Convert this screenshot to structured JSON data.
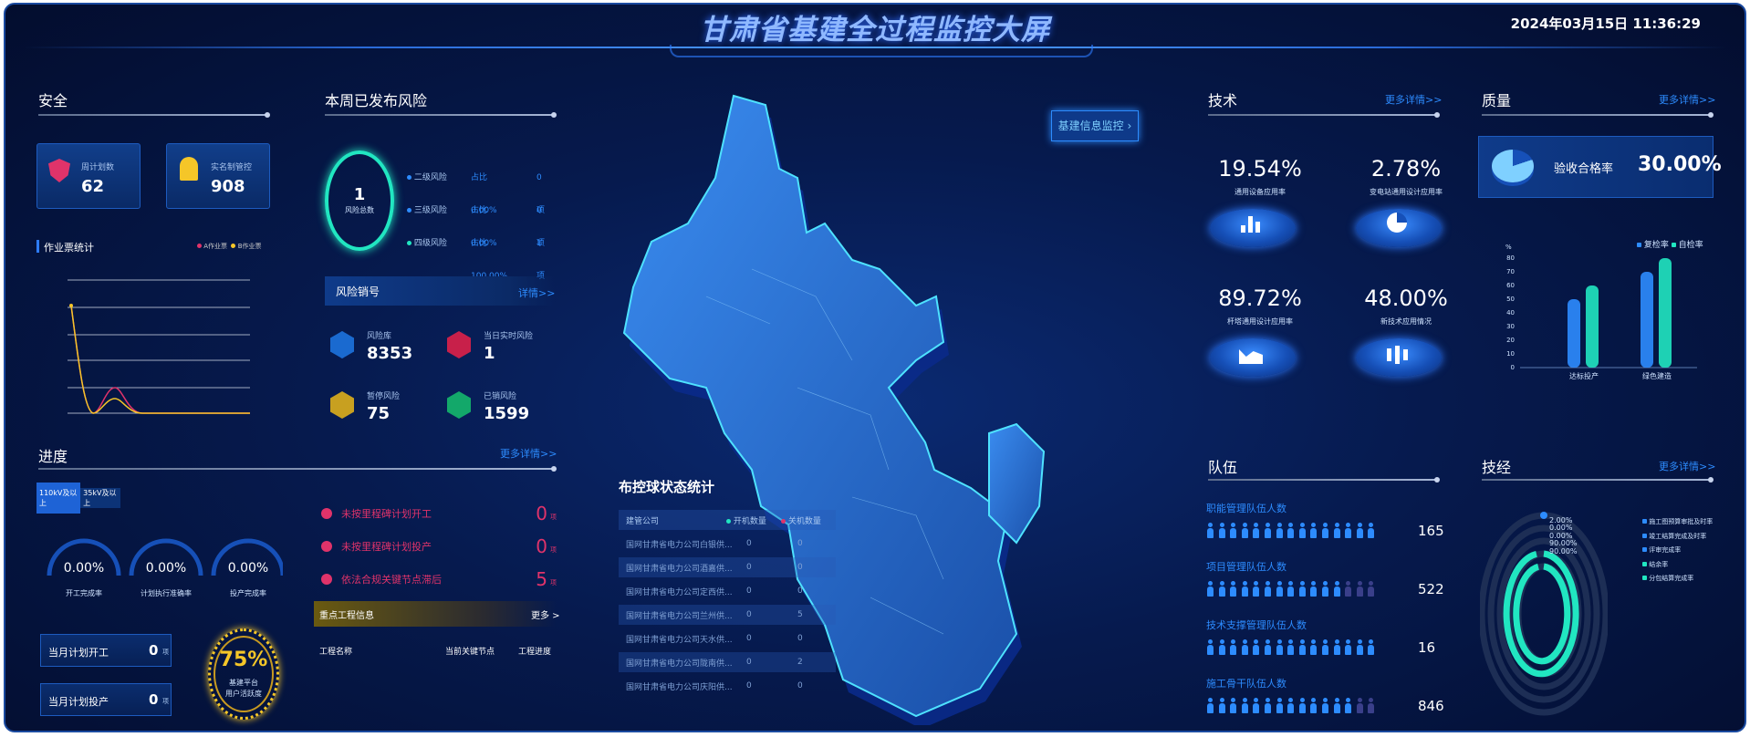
{
  "header": {
    "title": "甘肃省基建全过程监控大屏",
    "datetime": "2024年03月15日 11:36:29"
  },
  "safety": {
    "title": "安全",
    "cards": [
      {
        "label": "周计划数",
        "value": "62"
      },
      {
        "label": "实名制管控",
        "value": "908"
      }
    ],
    "chart_title": "作业票统计",
    "legend": [
      "A作业票",
      "B作业票"
    ]
  },
  "risk": {
    "title": "本周已发布风险",
    "total_value": "1",
    "total_label": "风险总数",
    "items": [
      {
        "name": "二级风险",
        "ratio": "占比 0.00%",
        "count": "0项"
      },
      {
        "name": "三级风险",
        "ratio": "占比 0.00%",
        "count": "0项"
      },
      {
        "name": "四级风险",
        "ratio": "占比 100.00%",
        "count": "1项"
      }
    ],
    "cancel_title": "风险销号",
    "cancel_more": "详情>>",
    "stats": [
      {
        "label": "风险库",
        "value": "8353"
      },
      {
        "label": "当日实时风险",
        "value": "1"
      },
      {
        "label": "暂停风险",
        "value": "75"
      },
      {
        "label": "已销风险",
        "value": "1599"
      }
    ]
  },
  "progress": {
    "title": "进度",
    "more": "更多详情>>",
    "tabs": [
      "110kV及以上",
      "35kV及以上"
    ],
    "gauges": [
      {
        "value": "0.00%",
        "label": "开工完成率"
      },
      {
        "value": "0.00%",
        "label": "计划执行准确率"
      },
      {
        "value": "0.00%",
        "label": "投产完成率"
      }
    ],
    "boxes": [
      {
        "label": "当月计划开工",
        "value": "0",
        "unit": "项"
      },
      {
        "label": "当月计划投产",
        "value": "0",
        "unit": "项"
      }
    ],
    "ring_value": "75%",
    "ring_label1": "基建平台",
    "ring_label2": "用户活跃度",
    "alerts": [
      {
        "text": "未按里程碑计划开工",
        "value": "0",
        "unit": "项"
      },
      {
        "text": "未按里程碑计划投产",
        "value": "0",
        "unit": "项"
      },
      {
        "text": "依法合规关键节点滞后",
        "value": "5",
        "unit": "项"
      }
    ],
    "key_title": "重点工程信息",
    "key_more": "更多 >",
    "key_cols": [
      "工程名称",
      "当前关键节点",
      "工程进度"
    ]
  },
  "map": {
    "button": "基建信息监控"
  },
  "ball": {
    "title": "布控球状态统计",
    "cols": [
      "建管公司",
      "开机数量",
      "关机数量"
    ],
    "rows": [
      {
        "name": "国网甘肃省电力公司白银供...",
        "on": "0",
        "off": "0"
      },
      {
        "name": "国网甘肃省电力公司酒嘉供...",
        "on": "0",
        "off": "0"
      },
      {
        "name": "国网甘肃省电力公司定西供...",
        "on": "0",
        "off": "0"
      },
      {
        "name": "国网甘肃省电力公司兰州供...",
        "on": "0",
        "off": "5"
      },
      {
        "name": "国网甘肃省电力公司天水供...",
        "on": "0",
        "off": "0"
      },
      {
        "name": "国网甘肃省电力公司陇南供...",
        "on": "0",
        "off": "2"
      },
      {
        "name": "国网甘肃省电力公司庆阳供...",
        "on": "0",
        "off": "0"
      }
    ]
  },
  "tech": {
    "title": "技术",
    "more": "更多详情>>",
    "items": [
      {
        "value": "19.54%",
        "label": "通用设备应用率"
      },
      {
        "value": "2.78%",
        "label": "变电站通用设计应用率"
      },
      {
        "value": "89.72%",
        "label": "杆塔通用设计应用率"
      },
      {
        "value": "48.00%",
        "label": "新技术应用情况"
      }
    ]
  },
  "quality": {
    "title": "质量",
    "more": "更多详情>>",
    "rate_label": "验收合格率",
    "rate_value": "30.00%",
    "legend": [
      "复检率",
      "自检率"
    ],
    "unit": "%",
    "chart_data": {
      "type": "bar",
      "categories": [
        "达标投产",
        "绿色建造"
      ],
      "series": [
        {
          "name": "复检率",
          "values": [
            50,
            70
          ]
        },
        {
          "name": "自检率",
          "values": [
            60,
            80
          ]
        }
      ],
      "ylim": [
        0,
        80
      ],
      "yticks": [
        "0",
        "10",
        "20",
        "30",
        "40",
        "50",
        "60",
        "70",
        "80"
      ]
    }
  },
  "team": {
    "title": "队伍",
    "rows": [
      {
        "label": "职能管理队伍人数",
        "value": "165",
        "filled": 15
      },
      {
        "label": "项目管理队伍人数",
        "value": "522",
        "filled": 12
      },
      {
        "label": "技术支撑管理队伍人数",
        "value": "16",
        "filled": 15
      },
      {
        "label": "施工骨干队伍人数",
        "value": "846",
        "filled": 13
      }
    ]
  },
  "techeco": {
    "title": "技经",
    "more": "更多详情>>",
    "values": [
      "2.00%",
      "0.00%",
      "0.00%",
      "90.00%",
      "90.00%"
    ],
    "legend": [
      "施工图预算审批及时率",
      "竣工结算完成及时率",
      "评审完成率",
      "结余率",
      "分包结算完成率"
    ]
  }
}
